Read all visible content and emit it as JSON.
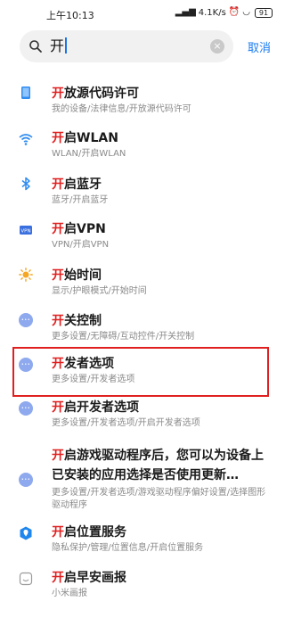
{
  "status": {
    "time": "上午10:13",
    "network_speed": "4.1K/s",
    "battery": "91"
  },
  "search": {
    "query": "开",
    "cancel_label": "取消"
  },
  "results": [
    {
      "hl": "开",
      "rest": "放源代码许可",
      "sub": "我的设备/法律信息/开放源代码许可",
      "icon": "phone-icon"
    },
    {
      "hl": "开",
      "rest": "启WLAN",
      "sub": "WLAN/开启WLAN",
      "icon": "wifi-icon"
    },
    {
      "hl": "开",
      "rest": "启蓝牙",
      "sub": "蓝牙/开启蓝牙",
      "icon": "bluetooth-icon"
    },
    {
      "hl": "开",
      "rest": "启VPN",
      "sub": "VPN/开启VPN",
      "icon": "vpn-icon"
    },
    {
      "hl": "开",
      "rest": "始时间",
      "sub": "显示/护眼模式/开始时间",
      "icon": "sun-icon"
    },
    {
      "hl": "开",
      "rest": "关控制",
      "sub": "更多设置/无障碍/互动控件/开关控制",
      "icon": "more-icon"
    },
    {
      "hl": "开",
      "rest": "发者选项",
      "sub": "更多设置/开发者选项",
      "icon": "more-icon"
    },
    {
      "hl": "开",
      "rest": "启开发者选项",
      "sub": "更多设置/开发者选项/开启开发者选项",
      "icon": "more-icon"
    },
    {
      "hl": "开",
      "rest": "启游戏驱动程序后，您可以为设备上已安装的应用选择是否使用更新…",
      "sub": "更多设置/开发者选项/游戏驱动程序偏好设置/选择图形驱动程序",
      "icon": "more-icon"
    },
    {
      "hl": "开",
      "rest": "启位置服务",
      "sub": "隐私保护/管理/位置信息/开启位置服务",
      "icon": "location-icon"
    },
    {
      "hl": "开",
      "rest": "启早安画报",
      "sub": "小米画报",
      "icon": "clock-icon"
    }
  ],
  "colors": {
    "highlight": "#e02020",
    "accent": "#1a7bf0",
    "icon_blue": "#2f8cf0"
  }
}
